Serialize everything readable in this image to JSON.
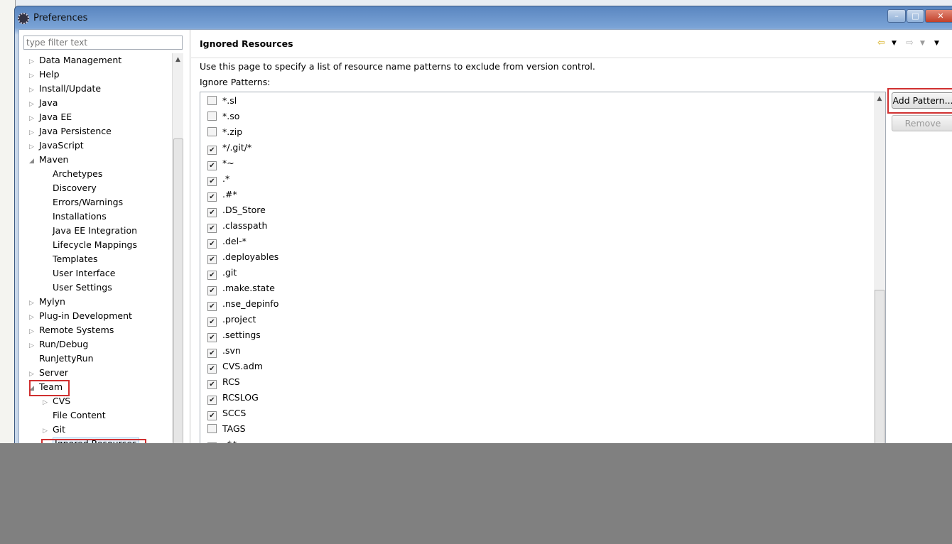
{
  "window": {
    "title": "Preferences",
    "minimize": "–",
    "maximize": "□",
    "close": "✕"
  },
  "filter": {
    "placeholder": "type filter text"
  },
  "tree": [
    {
      "label": "Data Management",
      "level": 0,
      "twisty": "collapsed"
    },
    {
      "label": "Help",
      "level": 0,
      "twisty": "collapsed"
    },
    {
      "label": "Install/Update",
      "level": 0,
      "twisty": "collapsed"
    },
    {
      "label": "Java",
      "level": 0,
      "twisty": "collapsed"
    },
    {
      "label": "Java EE",
      "level": 0,
      "twisty": "collapsed"
    },
    {
      "label": "Java Persistence",
      "level": 0,
      "twisty": "collapsed"
    },
    {
      "label": "JavaScript",
      "level": 0,
      "twisty": "collapsed"
    },
    {
      "label": "Maven",
      "level": 0,
      "twisty": "expanded"
    },
    {
      "label": "Archetypes",
      "level": 1,
      "twisty": "none"
    },
    {
      "label": "Discovery",
      "level": 1,
      "twisty": "none"
    },
    {
      "label": "Errors/Warnings",
      "level": 1,
      "twisty": "none"
    },
    {
      "label": "Installations",
      "level": 1,
      "twisty": "none"
    },
    {
      "label": "Java EE Integration",
      "level": 1,
      "twisty": "none"
    },
    {
      "label": "Lifecycle Mappings",
      "level": 1,
      "twisty": "none"
    },
    {
      "label": "Templates",
      "level": 1,
      "twisty": "none"
    },
    {
      "label": "User Interface",
      "level": 1,
      "twisty": "none"
    },
    {
      "label": "User Settings",
      "level": 1,
      "twisty": "none"
    },
    {
      "label": "Mylyn",
      "level": 0,
      "twisty": "collapsed"
    },
    {
      "label": "Plug-in Development",
      "level": 0,
      "twisty": "collapsed"
    },
    {
      "label": "Remote Systems",
      "level": 0,
      "twisty": "collapsed"
    },
    {
      "label": "Run/Debug",
      "level": 0,
      "twisty": "collapsed"
    },
    {
      "label": "RunJettyRun",
      "level": 0,
      "twisty": "none"
    },
    {
      "label": "Server",
      "level": 0,
      "twisty": "collapsed"
    },
    {
      "label": "Team",
      "level": 0,
      "twisty": "expanded"
    },
    {
      "label": "CVS",
      "level": 1,
      "twisty": "collapsed"
    },
    {
      "label": "File Content",
      "level": 1,
      "twisty": "none"
    },
    {
      "label": "Git",
      "level": 1,
      "twisty": "collapsed"
    },
    {
      "label": "Ignored Resources",
      "level": 1,
      "twisty": "none",
      "selected": true
    }
  ],
  "page": {
    "title": "Ignored Resources",
    "description": "Use this page to specify a list of resource name patterns to exclude from version control.",
    "patterns_label": "Ignore Patterns:",
    "add_button": "Add Pattern...",
    "remove_button": "Remove"
  },
  "patterns": [
    {
      "name": "*.sl",
      "checked": false
    },
    {
      "name": "*.so",
      "checked": false
    },
    {
      "name": "*.zip",
      "checked": false
    },
    {
      "name": "*/.git/*",
      "checked": true
    },
    {
      "name": "*~",
      "checked": true
    },
    {
      "name": ".*",
      "checked": true
    },
    {
      "name": ".#*",
      "checked": true
    },
    {
      "name": ".DS_Store",
      "checked": true
    },
    {
      "name": ".classpath",
      "checked": true
    },
    {
      "name": ".del-*",
      "checked": true
    },
    {
      "name": ".deployables",
      "checked": true
    },
    {
      "name": ".git",
      "checked": true
    },
    {
      "name": ".make.state",
      "checked": true
    },
    {
      "name": ".nse_depinfo",
      "checked": true
    },
    {
      "name": ".project",
      "checked": true
    },
    {
      "name": ".settings",
      "checked": true
    },
    {
      "name": ".svn",
      "checked": true
    },
    {
      "name": "CVS.adm",
      "checked": true
    },
    {
      "name": "RCS",
      "checked": true
    },
    {
      "name": "RCSLOG",
      "checked": true
    },
    {
      "name": "SCCS",
      "checked": true
    },
    {
      "name": "TAGS",
      "checked": false
    },
    {
      "name": "_$*",
      "checked": true
    }
  ],
  "colors": {
    "highlight": "#d03030",
    "overlay": "#808080"
  }
}
